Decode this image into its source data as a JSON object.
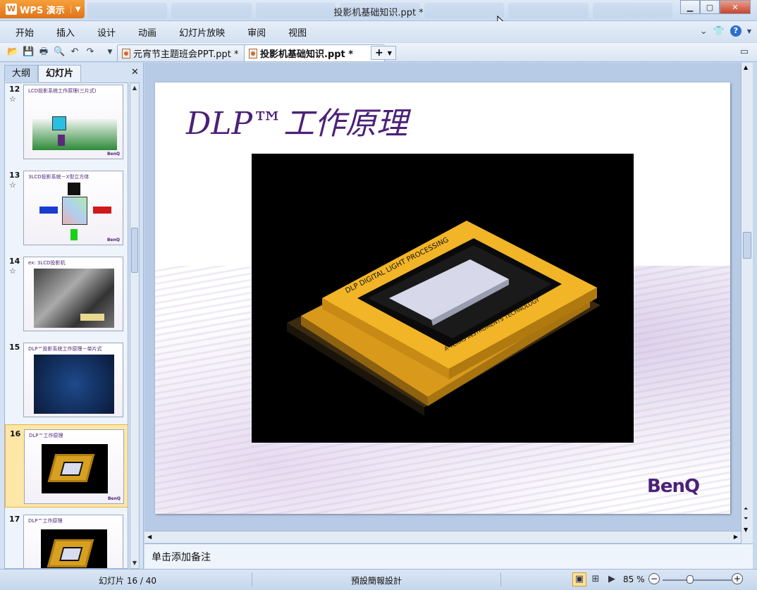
{
  "app": {
    "name": "WPS 演示",
    "window_title": "投影机基础知识.ppt *"
  },
  "menu": [
    "开始",
    "插入",
    "设计",
    "动画",
    "幻灯片放映",
    "审阅",
    "视图"
  ],
  "doc_tabs": [
    {
      "label": "元宵节主题班会PPT.ppt *",
      "active": false
    },
    {
      "label": "投影机基础知识.ppt *",
      "active": true
    }
  ],
  "panel": {
    "tabs": [
      "大纲",
      "幻灯片"
    ],
    "active_tab": "幻灯片",
    "thumbnails": [
      {
        "number": "12",
        "title": "LCD投影系统工作原理(三片式)",
        "selected": false
      },
      {
        "number": "13",
        "title": "3LCD投影系统－X型立方体",
        "selected": false
      },
      {
        "number": "14",
        "title": "ex: 3LCD投影机",
        "selected": false
      },
      {
        "number": "15",
        "title": "DLP™投影系统工作原理－单片式",
        "selected": false
      },
      {
        "number": "16",
        "title": "DLP™工作原理",
        "selected": true
      },
      {
        "number": "17",
        "title": "DLP™工作原理",
        "selected": false
      }
    ]
  },
  "slide": {
    "title": "DLP™工作原理",
    "logo": "BenQ",
    "chip_text_top": "DLP DIGITAL LIGHT PROCESSING",
    "chip_text_bottom": "A TEXAS INSTRUMENTS TECHNOLOGY"
  },
  "notes_placeholder": "单击添加备注",
  "status": {
    "slide_counter": "幻灯片 16 / 40",
    "design": "預設簡報設計",
    "zoom": "85 %",
    "zoom_level_percent": 85
  },
  "colors": {
    "accent": "#e0731a",
    "title_purple": "#4b2178",
    "chip_gold": "#d8a020"
  }
}
